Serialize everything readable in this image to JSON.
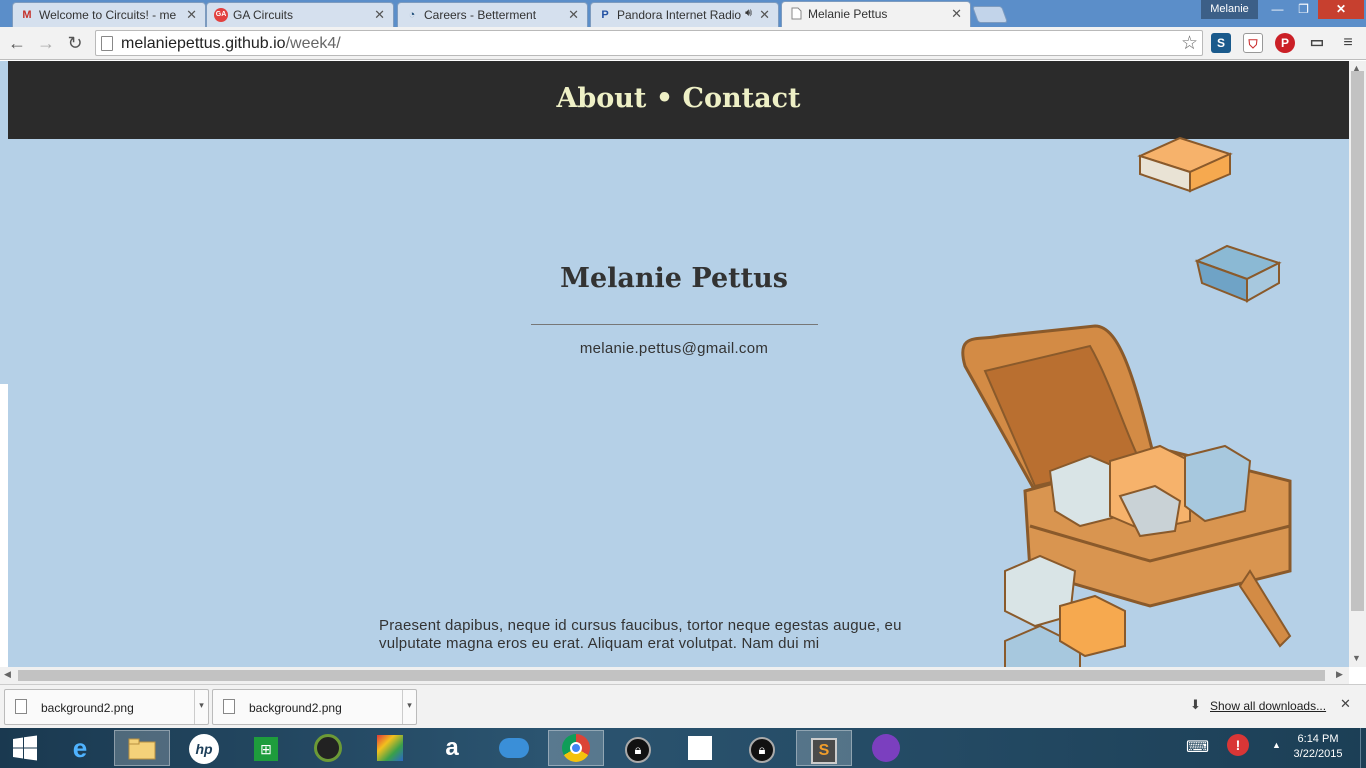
{
  "browser": {
    "tabs": [
      {
        "title": "Welcome to Circuits! - me",
        "icon": "gmail-icon",
        "color": "#c5312b"
      },
      {
        "title": "GA Circuits",
        "icon": "ga-icon",
        "color": "#e2413f"
      },
      {
        "title": "Careers - Betterment",
        "icon": "betterment-icon",
        "color": "#1f4e79"
      },
      {
        "title": "Pandora Internet Radio",
        "icon": "pandora-icon",
        "color": "#2251a3"
      },
      {
        "title": "Melanie Pettus",
        "icon": "page-icon",
        "color": "#888888"
      }
    ],
    "profile_name": "Melanie",
    "url_host": "melaniepettus.github.io",
    "url_path": "/week4/"
  },
  "page": {
    "nav": {
      "about": "About",
      "separator": "•",
      "contact": "Contact"
    },
    "name": "Melanie Pettus",
    "email": "melanie.pettus@gmail.com",
    "body_text": "Praesent dapibus, neque id cursus faucibus, tortor neque egestas augue, eu vulputate magna eros eu erat. Aliquam erat volutpat. Nam dui mi",
    "bg_color": "#b5d0e7",
    "nav_bg": "#2b2b2b",
    "nav_text_color": "#eef0c6"
  },
  "downloads": {
    "items": [
      {
        "filename": "background2.png"
      },
      {
        "filename": "background2.png"
      }
    ],
    "show_all": "Show all downloads..."
  },
  "taskbar": {
    "clock_time": "6:14 PM",
    "clock_date": "3/22/2015"
  }
}
